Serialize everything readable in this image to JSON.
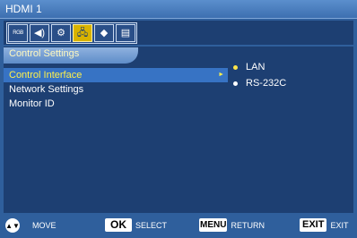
{
  "header": {
    "title": "HDMI 1"
  },
  "toolbar": {
    "icons": [
      {
        "name": "picture-rgb-icon",
        "glyph": "RGB",
        "selected": false
      },
      {
        "name": "sound-icon",
        "glyph": "◀)",
        "selected": false
      },
      {
        "name": "setup-gear-icon",
        "glyph": "⚙",
        "selected": false
      },
      {
        "name": "network-control-icon",
        "glyph": "🖧",
        "selected": true
      },
      {
        "name": "cube-option-icon",
        "glyph": "◆",
        "selected": false
      },
      {
        "name": "schedule-icon",
        "glyph": "▤",
        "selected": false
      }
    ]
  },
  "section": {
    "title": "Control Settings"
  },
  "menu": {
    "items": [
      {
        "label": "Control Interface",
        "active": true
      },
      {
        "label": "Network Settings",
        "active": false
      },
      {
        "label": "Monitor ID",
        "active": false
      }
    ],
    "arrow": "►"
  },
  "options": {
    "items": [
      {
        "label": "LAN",
        "selected": true
      },
      {
        "label": "RS-232C",
        "selected": false
      }
    ]
  },
  "footer": {
    "move": {
      "key": "▲▼",
      "label": "MOVE"
    },
    "select": {
      "key": "OK",
      "label": "SELECT"
    },
    "menu": {
      "key": "MENU",
      "label": "RETURN"
    },
    "exit": {
      "key": "EXIT",
      "label": "EXIT"
    }
  },
  "colors": {
    "background": "#2f5f9c",
    "panel": "#1d3f72",
    "highlight": "#3773c4",
    "accent_text": "#fff04a",
    "selected_icon": "#d9b300"
  }
}
